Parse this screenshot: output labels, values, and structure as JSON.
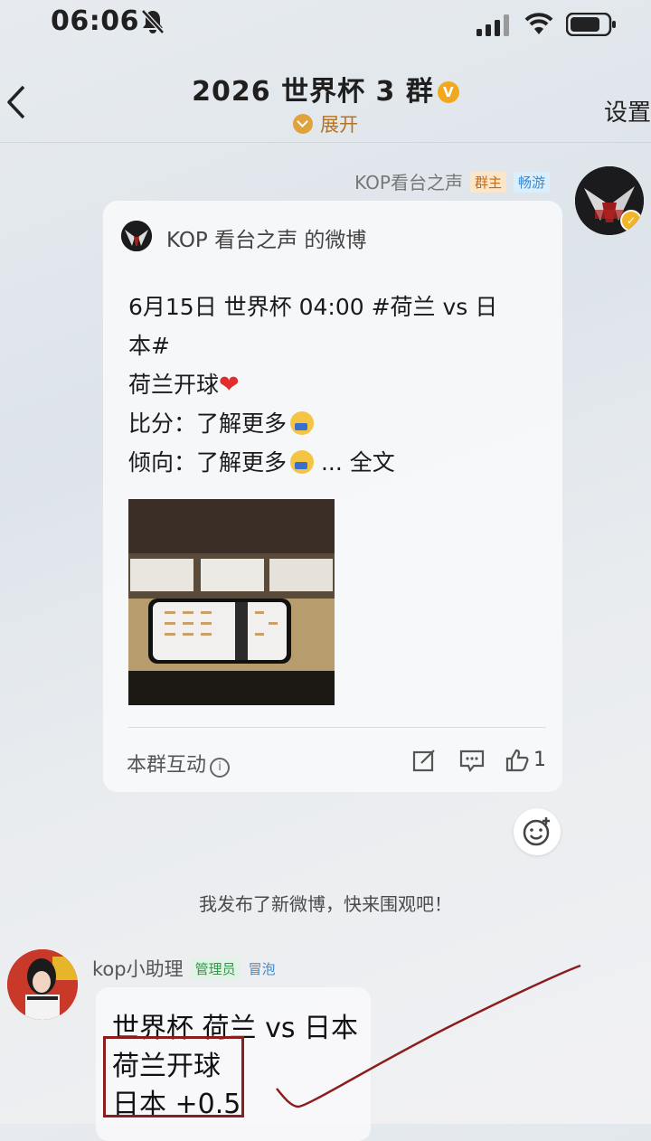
{
  "status_bar": {
    "time": "06:06"
  },
  "header": {
    "title": "2026 世界杯 3 群",
    "verified_mark": "V",
    "expand_label": "展开",
    "settings_label": "设置"
  },
  "message1": {
    "sender": "KOP看台之声",
    "owner_tag": "群主",
    "level_tag": "畅游",
    "card": {
      "source": "KOP 看台之声 的微博",
      "lines": [
        "6月15日 世界杯 04:00 #荷兰 vs 日",
        "本#",
        "荷兰开球",
        "比分：了解更多",
        "倾向：了解更多",
        "... 全文"
      ],
      "interaction_label": "本群互动",
      "info_glyph": "i",
      "like_count": "1"
    }
  },
  "system_message": "我发布了新微博，快来围观吧！",
  "message2": {
    "sender": "kop小助理",
    "admin_tag": "管理员",
    "bubble_tag": "冒泡",
    "lines": [
      "世界杯 荷兰 vs 日本",
      "荷兰开球",
      "日本 +0.5"
    ]
  },
  "colors": {
    "accent_gold": "#f2a81d",
    "annotation_red": "#8b1d1d"
  },
  "icons": [
    "bell-muted-icon",
    "signal-icon",
    "wifi-icon",
    "battery-icon",
    "back-arrow-icon",
    "verified-badge-icon",
    "expand-chevron-icon",
    "info-icon",
    "repost-icon",
    "comment-icon",
    "like-icon",
    "emoji-add-icon"
  ]
}
